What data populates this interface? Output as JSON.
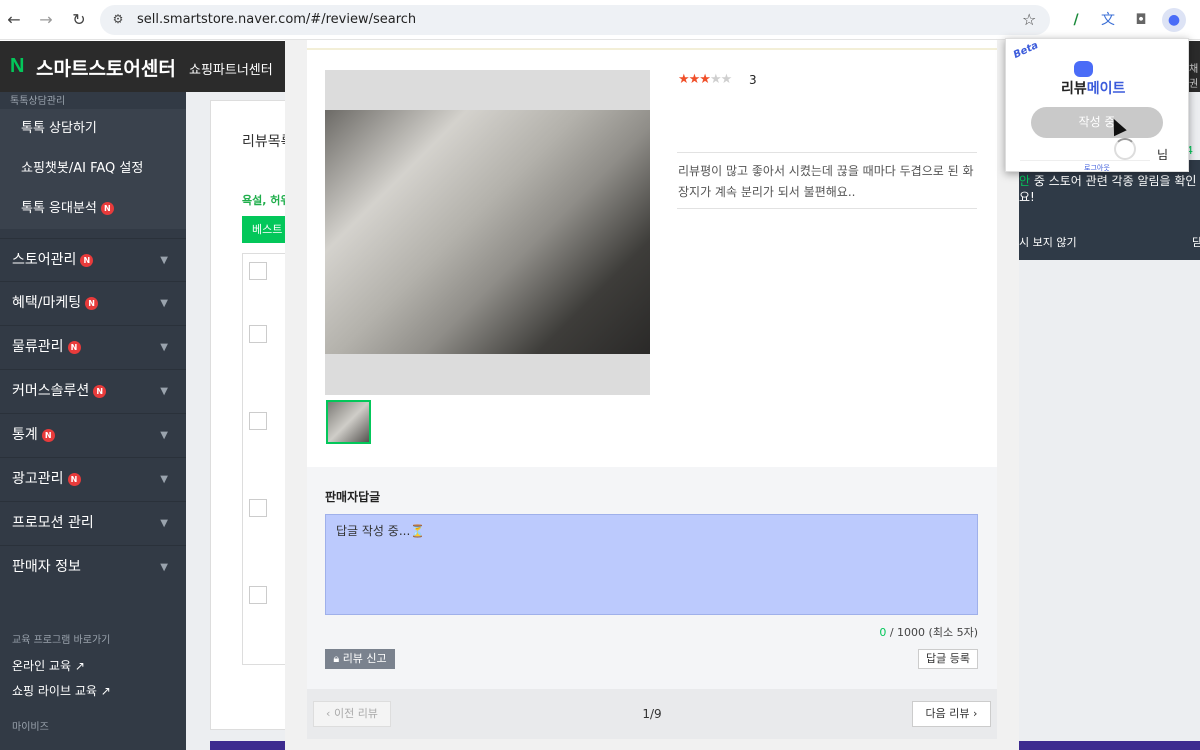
{
  "browser": {
    "url": "sell.smartstore.naver.com/#/review/search",
    "icons": [
      "back-icon",
      "forward-icon",
      "reload-icon",
      "site-info-icon",
      "bookmark-star-icon",
      "extension-pen-icon",
      "translate-icon",
      "camera-icon",
      "reviewmate-extension-icon"
    ]
  },
  "header": {
    "brand_letter": "N",
    "brand": "스마트스토어센터",
    "partner_link": "쇼핑파트너센터"
  },
  "sidebar": {
    "top_cut": "톡톡상담관리",
    "subitems": [
      "톡톡 상담하기",
      "쇼핑챗봇/AI FAQ 설정",
      "톡톡 응대분석"
    ],
    "items": [
      {
        "label": "스토어관리",
        "badge": "N"
      },
      {
        "label": "혜택/마케팅",
        "badge": "N"
      },
      {
        "label": "물류관리",
        "badge": "N"
      },
      {
        "label": "커머스솔루션",
        "badge": "N"
      },
      {
        "label": "통계",
        "badge": "N"
      },
      {
        "label": "광고관리",
        "badge": "N"
      },
      {
        "label": "프로모션 관리",
        "badge": ""
      },
      {
        "label": "판매자 정보",
        "badge": ""
      }
    ],
    "edu_title": "교육 프로그램 바로가기",
    "edu_links": [
      "온라인 교육 ↗",
      "쇼핑 라이브 교육 ↗"
    ],
    "my_title": "마이비즈"
  },
  "background_page": {
    "title": "리뷰목록",
    "warning": "욕설, 허위",
    "best_button": "베스트리"
  },
  "review": {
    "rating": 3,
    "rating_max": 5,
    "score_text": "3",
    "text": "리뷰평이 많고 좋아서 시켰는데 끊을 때마다 두겹으로 된 화장지가 계속 분리가 되서 불편해요..",
    "reply_label": "판매자답글",
    "reply_value": "답글 작성 중...⏳",
    "count_current": "0",
    "count_rest": " / 1000 (최소 5자)",
    "report_button": "리뷰 신고",
    "register_button": "답글 등록",
    "prev_button": "이전 리뷰",
    "next_button": "다음 리뷰",
    "page": "1/9"
  },
  "notification": {
    "line1_green": "안",
    "line1": " 중 스토어 관련 각종 알림을 확인",
    "line2": "요!",
    "dismiss": "시 보지 않기",
    "close_cut": "닫",
    "green_num": "4",
    "edge_text": "채권"
  },
  "popup": {
    "beta": "Beta",
    "title_a": "리뷰",
    "title_b": "메이트",
    "button": "작성 중",
    "nim": "님",
    "logout": "로그아웃"
  },
  "colors": {
    "accent_green": "#03c75a",
    "sidebar_bg": "#323a45",
    "reply_box_bg": "#bccafd",
    "star_on": "#f0502a"
  }
}
